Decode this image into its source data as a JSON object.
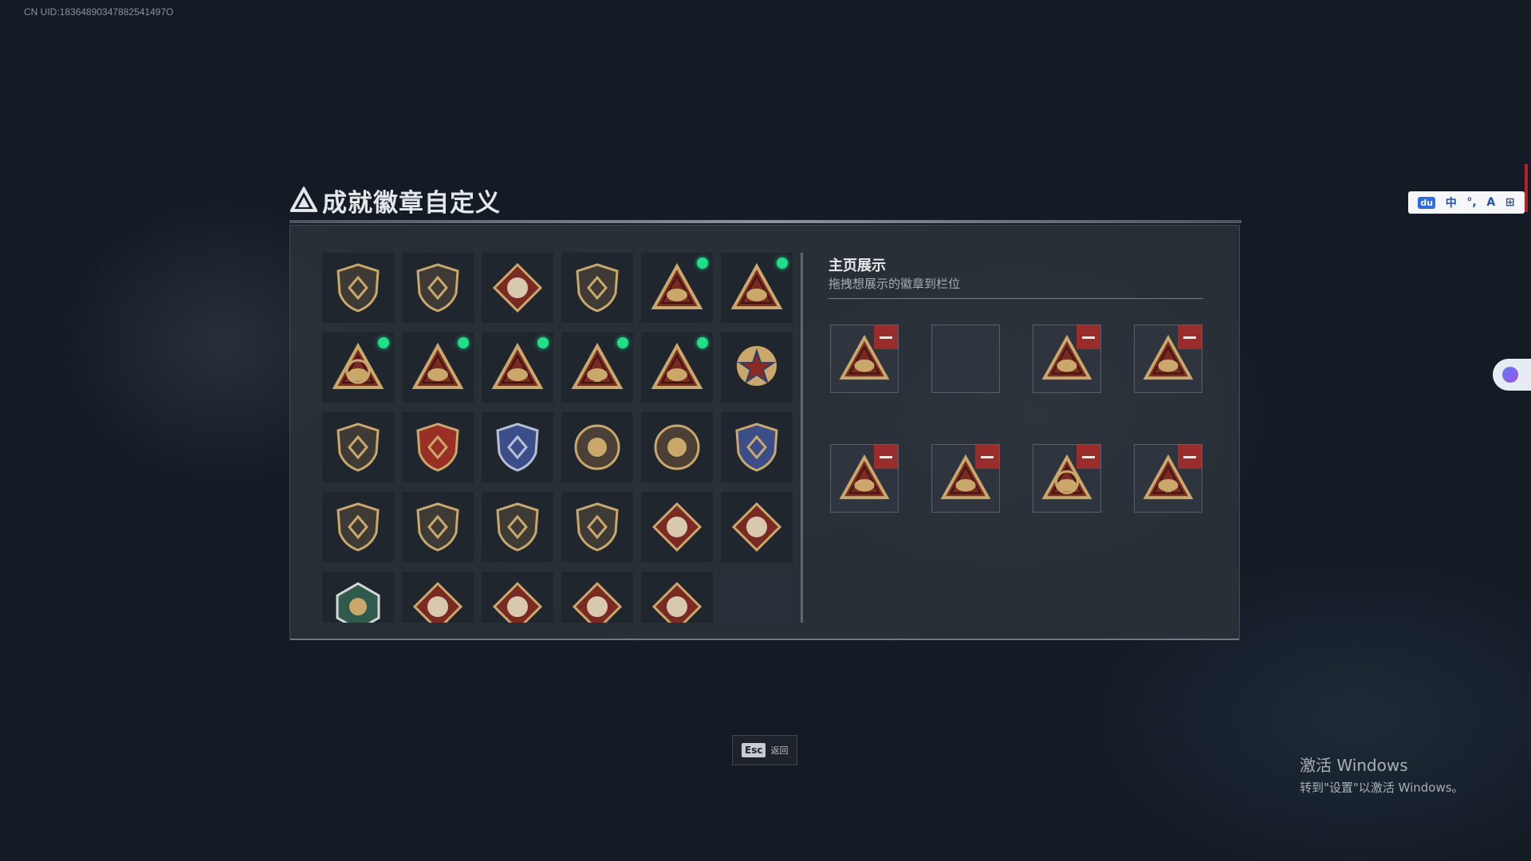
{
  "uid": "CN UID:18364890347882541497O",
  "title": "成就徽章自定义",
  "collection": {
    "badges": [
      {
        "icon": "triangle-shield-badge-icon",
        "new": false
      },
      {
        "icon": "helicopter-shield-badge-icon",
        "new": false
      },
      {
        "icon": "diamond-shield-badge-icon",
        "new": false
      },
      {
        "icon": "arrow-shield-badge-icon",
        "new": false
      },
      {
        "icon": "tank-triangle-badge-icon",
        "new": true
      },
      {
        "icon": "soldier-triangle-badge-icon",
        "new": true
      },
      {
        "icon": "eri-globe-triangle-badge-icon",
        "new": true
      },
      {
        "icon": "boat-triangle-badge-icon",
        "new": true
      },
      {
        "icon": "artillery-triangle-badge-icon",
        "new": true
      },
      {
        "icon": "number-one-triangle-badge-icon",
        "new": true
      },
      {
        "icon": "crate-triangle-badge-icon",
        "new": true
      },
      {
        "icon": "star-medal-badge-icon",
        "new": false
      },
      {
        "icon": "bronze-shield-badge-icon",
        "new": false
      },
      {
        "icon": "red-gold-shield-badge-icon",
        "new": false
      },
      {
        "icon": "blue-silver-shield-badge-icon",
        "new": false
      },
      {
        "icon": "skull-round-badge-icon",
        "new": false
      },
      {
        "icon": "gear-round-badge-icon",
        "new": false
      },
      {
        "icon": "crosshair-blue-shield-badge-icon",
        "new": false
      },
      {
        "icon": "crossed-rifles-gold-badge-icon",
        "new": false
      },
      {
        "icon": "no-rifle-shield-badge-icon",
        "new": false
      },
      {
        "icon": "no-rifle-shield-badge-icon",
        "new": false
      },
      {
        "icon": "crossed-rifles-gold-badge-icon",
        "new": false
      },
      {
        "icon": "wolf-diamond-badge-icon",
        "new": false
      },
      {
        "icon": "wolf-diamond-badge-icon",
        "new": false
      },
      {
        "icon": "dragon-green-hex-badge-icon",
        "new": false
      },
      {
        "icon": "dragon-red-diamond-badge-icon",
        "new": false
      },
      {
        "icon": "dragon-red-diamond-badge-icon",
        "new": false
      },
      {
        "icon": "runner-red-diamond-badge-icon",
        "new": false
      },
      {
        "icon": "tiger-red-diamond-badge-icon",
        "new": false
      },
      {
        "icon": "empty-slot",
        "new": false
      }
    ]
  },
  "showcase": {
    "title": "主页展示",
    "subtitle": "拖拽想展示的徽章到栏位",
    "slots": [
      {
        "icon": "crate-triangle-badge-icon",
        "filled": true
      },
      {
        "icon": "",
        "filled": false
      },
      {
        "icon": "boat-triangle-badge-icon",
        "filled": true
      },
      {
        "icon": "artillery-triangle-badge-icon",
        "filled": true
      },
      {
        "icon": "tank-triangle-badge-icon",
        "filled": true
      },
      {
        "icon": "soldier-triangle-badge-icon",
        "filled": true
      },
      {
        "icon": "eri-globe-triangle-badge-icon",
        "filled": true
      },
      {
        "icon": "number-one-triangle-badge-icon",
        "filled": true
      }
    ]
  },
  "footer": {
    "esc_key": "Esc",
    "esc_label": "返回"
  },
  "ime_toolbar": {
    "items": [
      "du",
      "中",
      "°,",
      "A",
      "⊞"
    ]
  },
  "watermark": {
    "line1": "激活 Windows",
    "line2": "转到\"设置\"以激活 Windows。"
  },
  "colors": {
    "new_dot": "#1ee08a",
    "remove": "#9a2d2b",
    "gold": "#c9a86a",
    "badge_red": "#7a2a22"
  }
}
